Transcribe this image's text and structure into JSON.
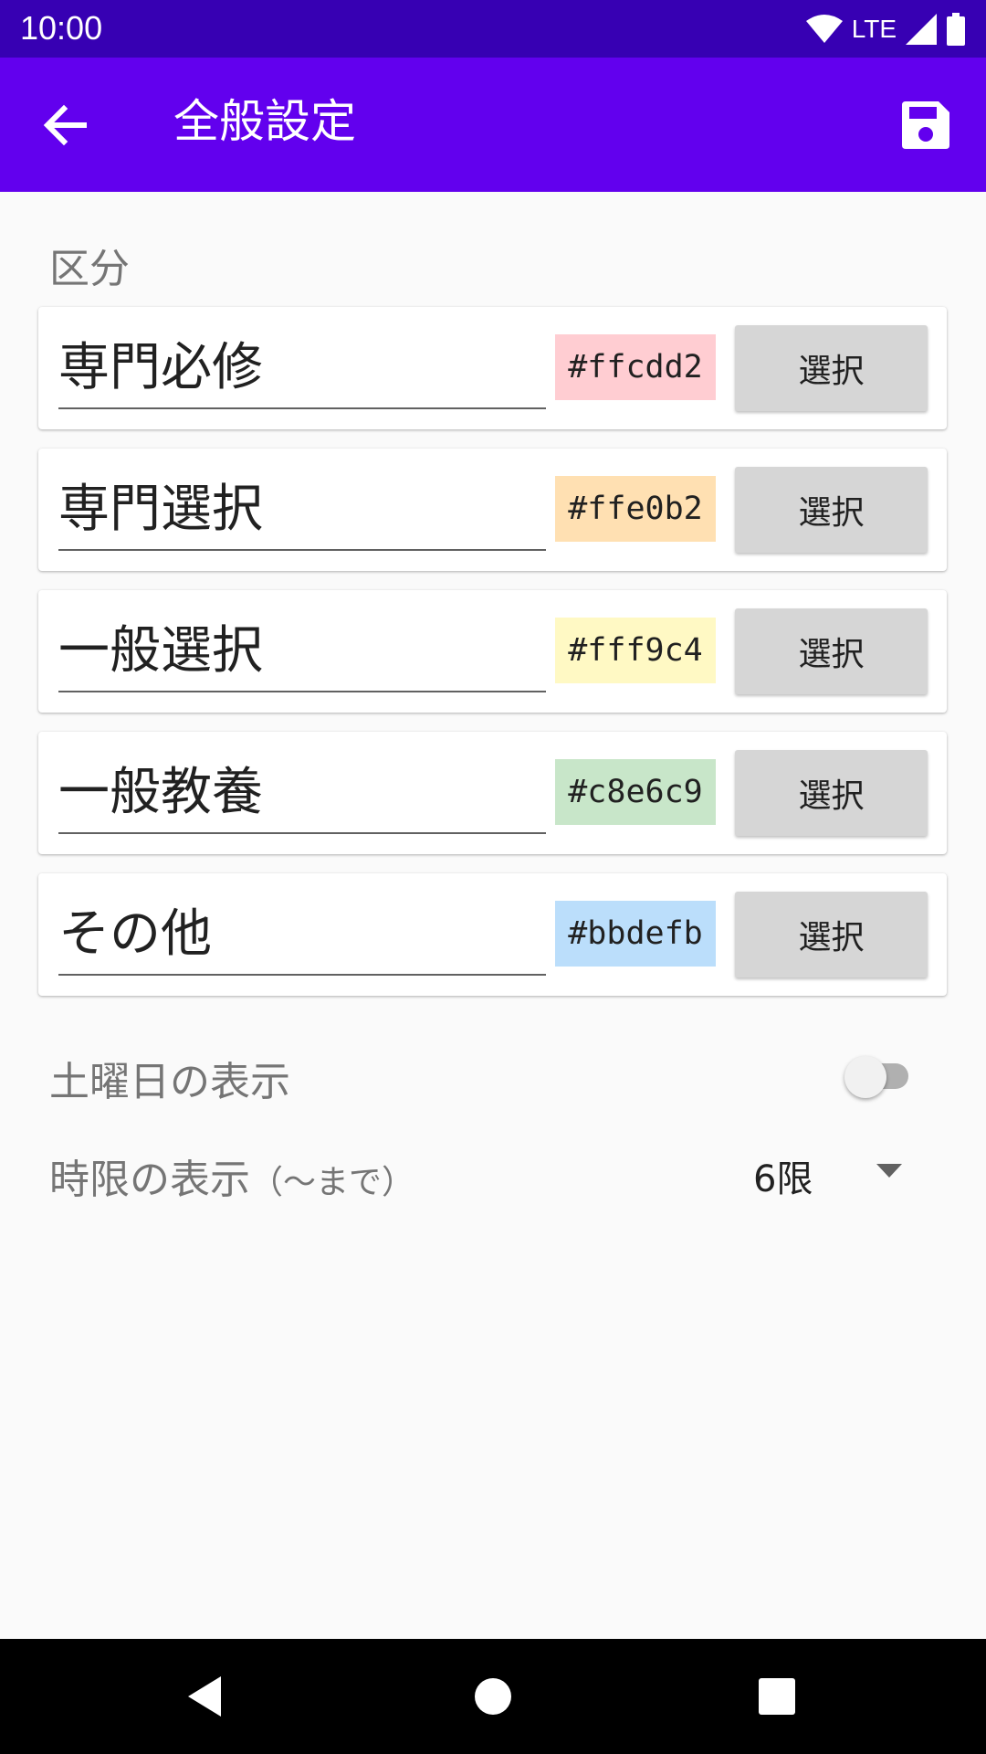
{
  "status_bar": {
    "time": "10:00",
    "network": "LTE"
  },
  "app_bar": {
    "title": "全般設定",
    "back_icon": "arrow-back-icon",
    "save_icon": "save-icon"
  },
  "section": {
    "label": "区分"
  },
  "categories": [
    {
      "name": "専門必修",
      "color": "#ffcdd2",
      "button": "選択"
    },
    {
      "name": "専門選択",
      "color": "#ffe0b2",
      "button": "選択"
    },
    {
      "name": "一般選択",
      "color": "#fff9c4",
      "button": "選択"
    },
    {
      "name": "一般教養",
      "color": "#c8e6c9",
      "button": "選択"
    },
    {
      "name": "その他",
      "color": "#bbdefb",
      "button": "選択"
    }
  ],
  "saturday": {
    "label": "土曜日の表示",
    "enabled": false
  },
  "period": {
    "label": "時限の表示",
    "note": "（〜まで）",
    "value": "6限"
  }
}
